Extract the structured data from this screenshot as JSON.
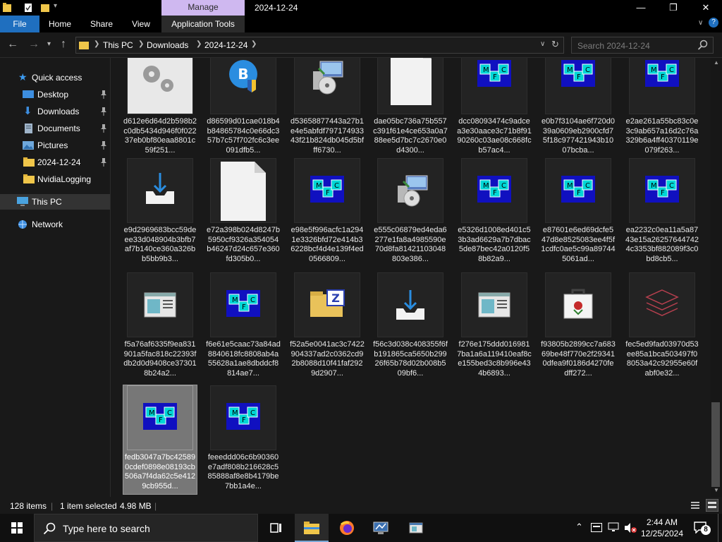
{
  "window": {
    "context_tab": "Manage",
    "title": "2024-12-24",
    "min_icon": "minimize-icon",
    "max_icon": "maximize-icon",
    "close_icon": "close-icon"
  },
  "ribbon": {
    "tabs": [
      "File",
      "Home",
      "Share",
      "View",
      "Application Tools"
    ]
  },
  "address": {
    "segments": [
      "This PC",
      "Downloads",
      "2024-12-24"
    ]
  },
  "search": {
    "placeholder": "Search 2024-12-24"
  },
  "nav": {
    "items": [
      {
        "label": "Quick access",
        "icon": "star-icon"
      },
      {
        "label": "Desktop",
        "icon": "desktop-icon",
        "pinned": true
      },
      {
        "label": "Downloads",
        "icon": "download-icon",
        "pinned": true
      },
      {
        "label": "Documents",
        "icon": "documents-icon",
        "pinned": true
      },
      {
        "label": "Pictures",
        "icon": "pictures-icon",
        "pinned": true
      },
      {
        "label": "2024-12-24",
        "icon": "folder-icon",
        "pinned": true
      },
      {
        "label": "NvidiaLogging",
        "icon": "folder-icon"
      },
      {
        "label": "This PC",
        "icon": "computer-icon"
      },
      {
        "label": "Network",
        "icon": "network-icon"
      }
    ]
  },
  "files": [
    {
      "name": "d612e6d64d2b598b2c0db5434d946f0f02237eb0bf80eaa8801c59f251...",
      "icon": "settings-file-icon"
    },
    {
      "name": "d86599d01cae018b4b84865784c0e66dc357b7c57f702fc6c3ee091dfb5...",
      "icon": "bitcoin-installer-icon"
    },
    {
      "name": "d53658877443a27b1e4e5abfdf79717493343f21b824db045d5bfff6730...",
      "icon": "installer-icon"
    },
    {
      "name": "dae05bc736a75b557c391f61e4ce653a0a788ee5d7bc7c2670e0d4300...",
      "icon": "blank-file-icon"
    },
    {
      "name": "dcc08093474c9adcea3e30aace3c71b8f9190260c03ae08c668fcb57ac4...",
      "icon": "mfc-app-icon"
    },
    {
      "name": "e0b7f3104ae6f720d039a0609eb2900cfd75f18c977421943b1007bcba...",
      "icon": "mfc-app-icon"
    },
    {
      "name": "e2ae261a55bc83c0e3c9ab657a16d2c76a329b6a4ff40370119e079f263...",
      "icon": "mfc-app-icon"
    },
    {
      "name": "e9d2969683bcc59deee33d048904b3bfb7af7b140ce360a326bb5bb9b3...",
      "icon": "download-tray-icon"
    },
    {
      "name": "e72a398b024d8247b5950cf9326a354054b46247d24c657e360fd305b0...",
      "icon": "blank-file-icon"
    },
    {
      "name": "e98e5f996acfc1a2941e3326bfd72e414b36228bcf4d4e139f4ed0566809...",
      "icon": "mfc-app-icon"
    },
    {
      "name": "e555c06879ed4eda6277e1fa8a4985590e70d8fa81421103048803e386...",
      "icon": "installer-icon"
    },
    {
      "name": "e5326d1008ed401c53b3ad6629a7b7dbac5de87bec42a0120f58b82a9...",
      "icon": "mfc-app-icon"
    },
    {
      "name": "e87601e6ed69dcfe547d8e8525083ee4f5f1cdfc0ae5c99a897445061ad...",
      "icon": "mfc-app-icon"
    },
    {
      "name": "ea2232c0ea11a5a8743e15a262576447424c3353bf882089f3c0bd8cb5...",
      "icon": "mfc-app-icon"
    },
    {
      "name": "f5a76af6335f9ea831901a5fac818c22393fdb2d0d9408ce373018b24a2...",
      "icon": "window-app-icon"
    },
    {
      "name": "f6e61e5caac73a84ad8840618fc8808ab4a55628a1ae8dbddcf8814ae7...",
      "icon": "mfc-app-icon"
    },
    {
      "name": "f52a5e0041ac3c7422904337ad2c0362cd92b8088d10f41faf2929d2907...",
      "icon": "zip-folder-icon"
    },
    {
      "name": "f56c3d038c408355f6fb191865ca5650b29926f65b78d02b008b509bf6...",
      "icon": "download-tray-icon"
    },
    {
      "name": "f276e175ddd0169817ba1a6a119410eaf8ce155bed3c8b996e434b6893...",
      "icon": "window-app-icon"
    },
    {
      "name": "f93805b2899cc7a68369be48f770e2f293410dfea9f0186d4270fedff272...",
      "icon": "briefcase-rose-icon"
    },
    {
      "name": "fec5ed9fad03970d53ee85a1bca503497f08053a42c92955e60fabf0e32...",
      "icon": "layers-icon"
    },
    {
      "name": "fedb3047a7bc425890cdef0898e08193cb506a7f4da62c5e4129cb955d...",
      "icon": "mfc-app-icon",
      "selected": true
    },
    {
      "name": "feeeddd06c6b90360e7adf808b216628c585888af8e8b4179be7bb1a4e...",
      "icon": "mfc-app-icon"
    }
  ],
  "status": {
    "count": "128 items",
    "selected": "1 item selected",
    "size": "4.98 MB"
  },
  "taskbar": {
    "search_placeholder": "Type here to search",
    "time": "2:44 AM",
    "date": "12/25/2024",
    "notification_count": "8"
  },
  "colors": {
    "accent": "#1f6fbf",
    "manage_tab": "#cfb8f0",
    "selection": "#777777",
    "background": "#191919"
  }
}
